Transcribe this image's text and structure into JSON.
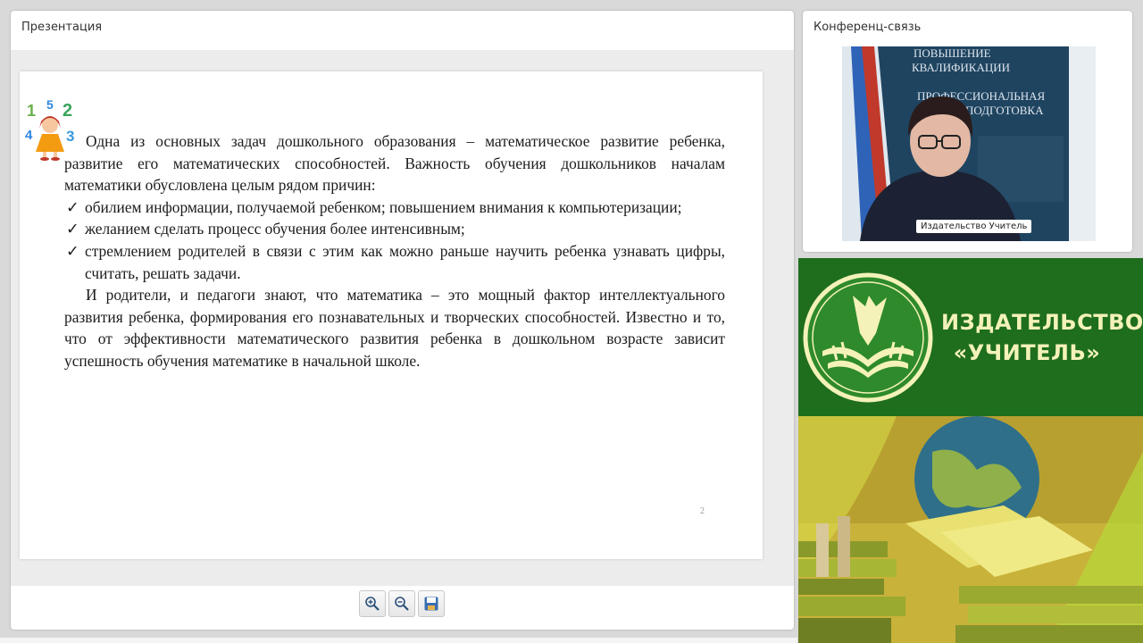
{
  "presentation": {
    "title": "Презентация",
    "slide": {
      "paragraph1": "Одна из основных задач дошкольного образования – математическое развитие ребенка, развитие его математических способностей. Важность обучения дошкольников началам математики обусловлена целым рядом причин:",
      "bullets": [
        "обилием информации, получаемой ребенком; повышением внимания к компьютеризации;",
        "желанием сделать процесс обучения более интенсивным;",
        "стремлением родителей в связи с этим как можно раньше научить ребенка узнавать цифры, считать, решать задачи."
      ],
      "check_glyph": "✓",
      "paragraph2": "И родители, и педагоги знают, что математика – это мощный фактор интеллектуального развития ребенка, формирования его познавательных и творческих способностей. Известно и то, что от эффективности математического развития ребенка в дошкольном возрасте зависит успешность обучения математике в начальной школе.",
      "page_number": "2",
      "image_digits": [
        "1",
        "5",
        "2",
        "4",
        "3"
      ]
    },
    "toolbar": {
      "zoom_in_icon": "zoom-in-icon",
      "zoom_out_icon": "zoom-out-icon",
      "save_icon": "floppy-disk-icon"
    }
  },
  "conference": {
    "title": "Конференц-связь",
    "video": {
      "participant_name": "Издательство Учитель",
      "poster_lines": [
        "ПОВЫШЕНИЕ",
        "КВАЛИФИКАЦИИ",
        "ПРОФЕССИОНАЛЬНАЯ",
        "ПОДГОТОВКА"
      ]
    }
  },
  "banner": {
    "line1": "ИЗДАТЕЛЬСТВО",
    "line2": "«УЧИТЕЛЬ»",
    "colors": {
      "green": "#1e6e1e",
      "cream": "#f4f2b8"
    }
  }
}
